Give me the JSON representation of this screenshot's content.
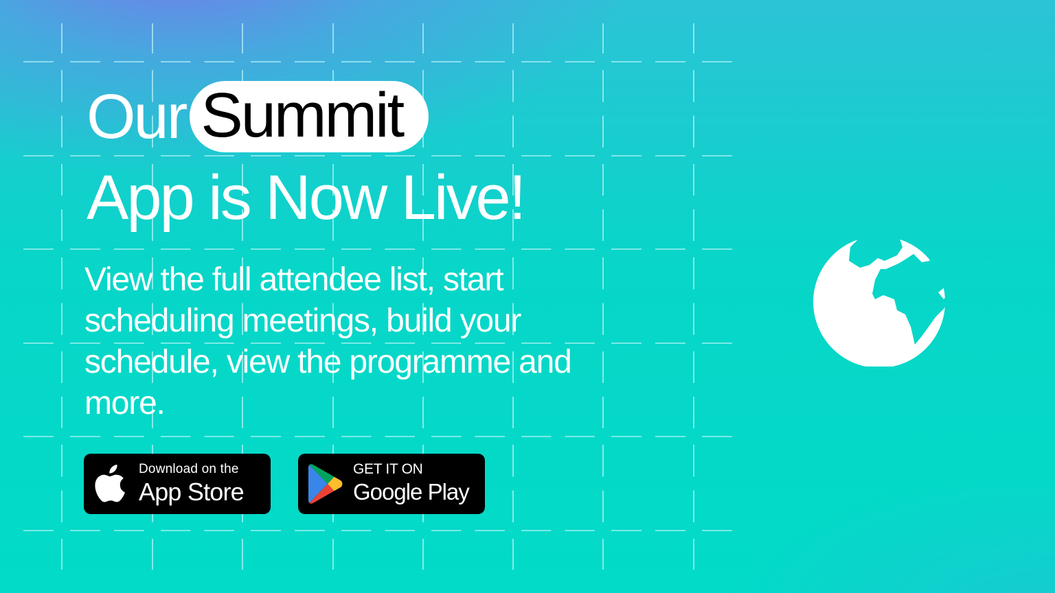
{
  "banner": {
    "headline": {
      "word_before_pill": "Our",
      "pill_word": "Summit",
      "second_line": "App is Now Live!"
    },
    "description": "View the full attendee list, start scheduling meetings, build your schedule, view the programme and more.",
    "buttons": {
      "app_store": {
        "small_label": "Download on the",
        "big_label": "App Store",
        "icon": "apple-logo-icon"
      },
      "google_play": {
        "small_label": "GET IT ON",
        "big_label": "Google Play",
        "icon": "google-play-logo-icon"
      }
    },
    "globe_icon": "globe-africa-europe-icon"
  },
  "colors": {
    "background_top_left": "#7b7ee6",
    "background_main": "#02dbc8",
    "text": "#ffffff",
    "pill_background": "#ffffff",
    "pill_text": "#000000",
    "button_background": "#000000",
    "grid_line": "#bff5fa",
    "google_play_green": "#01a45f",
    "google_play_blue": "#3a86e8",
    "google_play_yellow": "#fdbd2c",
    "google_play_red": "#ea4335"
  }
}
